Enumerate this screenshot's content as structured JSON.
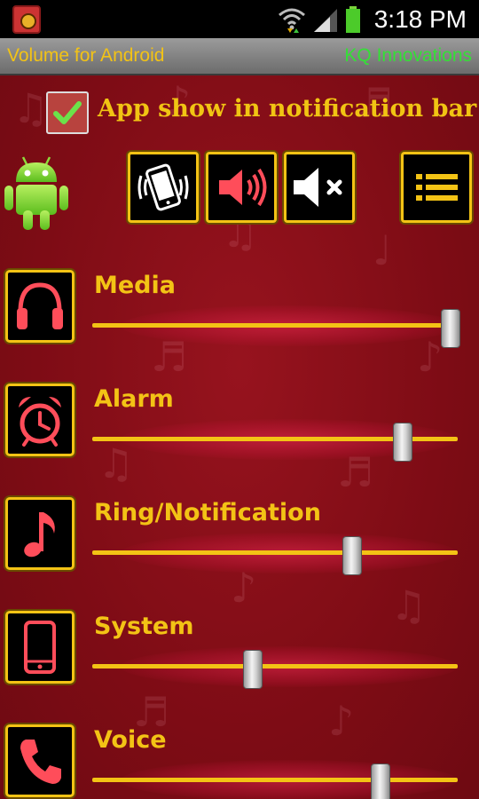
{
  "status_bar": {
    "time": "3:18 PM",
    "icons": [
      "app-notification-icon",
      "wifi-icon",
      "signal-icon",
      "battery-icon"
    ]
  },
  "title_bar": {
    "title": "Volume for Android",
    "company": "KQ Innovations",
    "title_color": "#f3c315",
    "company_color": "#34e036"
  },
  "notification_option": {
    "label": "App show in notification bar",
    "checked": true
  },
  "mode_buttons": [
    {
      "name": "vibrate-mode-button",
      "icon": "vibrate-phone-icon"
    },
    {
      "name": "sound-on-button",
      "icon": "speaker-on-icon"
    },
    {
      "name": "mute-button",
      "icon": "speaker-mute-icon"
    },
    {
      "name": "menu-list-button",
      "icon": "list-icon"
    }
  ],
  "volume_channels": [
    {
      "label": "Media",
      "icon": "headphones-icon",
      "level": 0.98
    },
    {
      "label": "Alarm",
      "icon": "alarm-clock-icon",
      "level": 0.85
    },
    {
      "label": "Ring/Notification",
      "icon": "music-note-icon",
      "level": 0.71
    },
    {
      "label": "System",
      "icon": "smartphone-icon",
      "level": 0.44
    },
    {
      "label": "Voice",
      "icon": "phone-handset-icon",
      "level": 0.79
    }
  ],
  "colors": {
    "accent": "#f3c315",
    "background": "#7a0a12",
    "icon_red": "#ff4d5a"
  }
}
